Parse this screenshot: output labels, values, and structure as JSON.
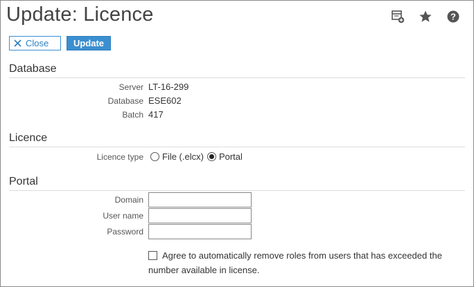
{
  "page": {
    "title": "Update: Licence"
  },
  "toolbar": {
    "icons": [
      "add-to-dashboard-icon",
      "star-icon",
      "help-icon"
    ],
    "close_label": "Close",
    "update_label": "Update"
  },
  "database": {
    "heading": "Database",
    "server_label": "Server",
    "server_value": "LT-16-299",
    "database_label": "Database",
    "database_value": "ESE602",
    "batch_label": "Batch",
    "batch_value": "417"
  },
  "licence": {
    "heading": "Licence",
    "type_label": "Licence type",
    "options": [
      {
        "label": "File (.elcx)",
        "checked": false
      },
      {
        "label": "Portal",
        "checked": true
      }
    ]
  },
  "portal": {
    "heading": "Portal",
    "domain_label": "Domain",
    "domain_value": "",
    "username_label": "User name",
    "username_value": "",
    "password_label": "Password",
    "password_value": "",
    "agree_text": "Agree to automatically remove roles from users that has exceeded the number available in license.",
    "agree_checked": false
  },
  "colors": {
    "accent": "#3b8fd0",
    "frame_border": "#8a8a8a"
  }
}
